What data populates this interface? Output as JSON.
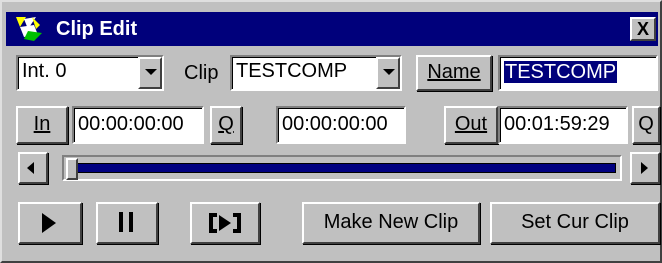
{
  "window": {
    "title": "Clip Edit",
    "close_label": "X"
  },
  "row1": {
    "channel_value": "Int. 0",
    "clip_label": "Clip",
    "clip_value": "TESTCOMP",
    "name_button": "Name",
    "name_value": "TESTCOMP"
  },
  "row2": {
    "in_button": "In",
    "in_time": "00:00:00:00",
    "q_in": "Q",
    "duration_time": "00:00:00:00",
    "out_button": "Out",
    "out_time": "00:01:59:29",
    "q_out": "Q"
  },
  "scrub": {
    "position": 0.0
  },
  "row4": {
    "make_new_clip": "Make New Clip",
    "set_cur_clip": "Set Cur Clip"
  }
}
